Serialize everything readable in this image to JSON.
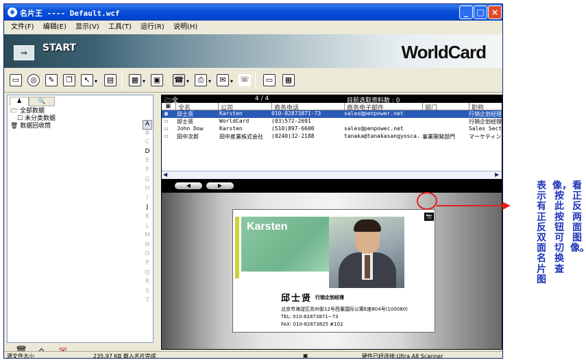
{
  "window": {
    "title": "名片王 ---- Default.wcf",
    "minimize": "_",
    "maximize": "□",
    "close": "×"
  },
  "menu": [
    "文件(F)",
    "编辑(E)",
    "显示(V)",
    "工具(T)",
    "运行(R)",
    "说明(H)"
  ],
  "banner": {
    "start_label": "START",
    "brand": "WorldCard"
  },
  "toolbar": {
    "icons": [
      "save-icon",
      "scan-icon",
      "edit-icon",
      "copy-icon",
      "select-icon",
      "view-icon",
      "print-icon",
      "export-icon",
      "phone-icon",
      "fax-icon",
      "email-icon",
      "dial-icon",
      "doc-icon",
      "layout-icon"
    ]
  },
  "left_tabs": [
    "contacts-tab",
    "search-tab"
  ],
  "tree": [
    {
      "label": "全部数据",
      "level": 0
    },
    {
      "label": "未分类数据",
      "level": 1
    },
    {
      "label": "数据回收筒",
      "level": 0
    }
  ],
  "alpha_index": [
    "A",
    "B",
    "C",
    "D",
    "E",
    "F",
    "G",
    "H",
    "I",
    "J",
    "K",
    "L",
    "M",
    "N",
    "O",
    "P",
    "Q",
    "R",
    "S",
    "T"
  ],
  "list": {
    "folder": "全部数据",
    "count": "4 / 4",
    "selected_label": "目前选取资料数 : 0",
    "columns": [
      "全名",
      "公司",
      "商务电话",
      "商务电子邮件",
      "部门",
      "职称"
    ],
    "rows": [
      {
        "name": "邱士贤",
        "company": "Karsten",
        "phone": "010-82873871-73",
        "email": "sales@penpower.net",
        "dept": "",
        "title": "行销企划经理"
      },
      {
        "name": "邱士贤",
        "company": "WorldCard",
        "phone": "(03)572-2691",
        "email": "",
        "dept": "",
        "title": "行销企划经理"
      },
      {
        "name": "John Dow",
        "company": "Karsten",
        "phone": "(510)897-6600",
        "email": "sales@penpowec.net",
        "dept": "",
        "title": "Sales Section"
      },
      {
        "name": "田中次郎",
        "company": "田中産業株式会社",
        "phone": "(0240)32-2188",
        "email": "tanaka@tanakasangyosca...",
        "dept": "事業開発部門",
        "title": "マーケティン"
      }
    ]
  },
  "card": {
    "brand": "Karsten",
    "name": "邱士贤",
    "title": "行销企划经理",
    "address": "北京市海淀区苏州街12号西董国际公寓E座804号(100080)",
    "tel": "TEL: 010-82873871~73",
    "fax": "FAX: 010-82873825 #102"
  },
  "status": {
    "left": "源文件大小",
    "size": "235.97 KB 载入名片完成",
    "device": "硬件已经连接:Ultra A8 Scanner"
  },
  "annotation": {
    "col1": "看正反两面图像。",
    "col2": "像，按此按钮可切换查",
    "col3": "表示有正反双面名片图"
  },
  "colors": {
    "annotation": "#1e35b8",
    "highlight": "#e02020",
    "selection": "#2a5ab8"
  }
}
